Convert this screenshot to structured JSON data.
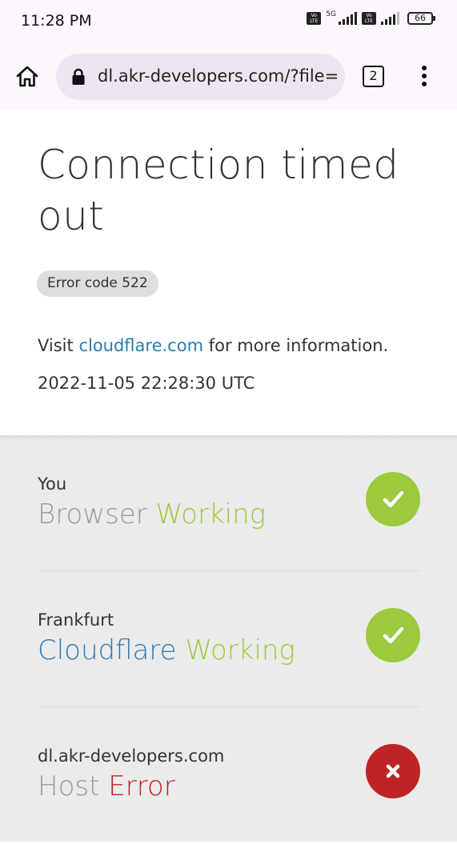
{
  "status_bar": {
    "time": "11:28 PM",
    "network": "5G",
    "volte": "Vo LTE",
    "battery": "66"
  },
  "browser": {
    "url": "dl.akr-developers.com/?file=",
    "tab_count": "2",
    "icons": [
      "home-icon",
      "lock-icon",
      "tab-switcher-icon",
      "more-vert-icon"
    ]
  },
  "error": {
    "title": "Connection timed out",
    "code_badge": "Error code 522",
    "info_prefix": "Visit ",
    "info_link": "cloudflare.com",
    "info_suffix": " for more information.",
    "timestamp": "2022-11-05 22:28:30 UTC"
  },
  "diagnostics": [
    {
      "location": "You",
      "name": "Browser",
      "status": "Working",
      "state": "ok"
    },
    {
      "location": "Frankfurt",
      "name": "Cloudflare",
      "status": "Working",
      "state": "ok"
    },
    {
      "location": "dl.akr-developers.com",
      "name": "Host",
      "status": "Error",
      "state": "error"
    }
  ],
  "colors": {
    "link": "#2c7cb0",
    "ok": "#9bca3e",
    "error": "#bd2426",
    "panel": "#ebebeb"
  }
}
